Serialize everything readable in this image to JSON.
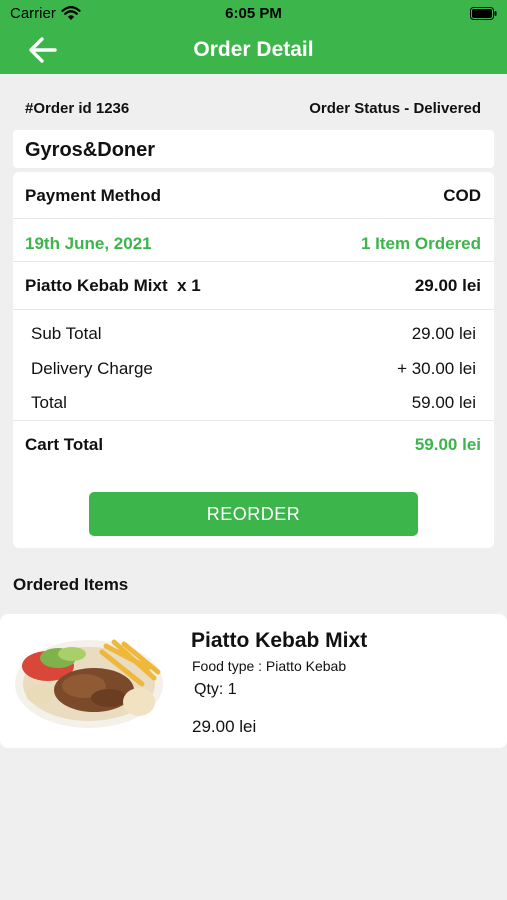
{
  "status_bar": {
    "carrier": "Carrier",
    "time": "6:05 PM"
  },
  "header": {
    "title": "Order Detail",
    "back_icon": "arrow-left-icon"
  },
  "order": {
    "id_label": "#Order id 1236",
    "status_label": "Order Status - Delivered",
    "restaurant": "Gyros&Doner"
  },
  "details": {
    "payment_label": "Payment Method",
    "payment_value": "COD",
    "date": "19th June, 2021",
    "items_ordered": "1 Item Ordered",
    "line_item": "Piatto Kebab Mixt  x 1",
    "line_item_price": "29.00 lei",
    "sub_total_label": "Sub Total",
    "sub_total_value": "29.00 lei",
    "delivery_label": "Delivery Charge",
    "delivery_value": "+ 30.00 lei",
    "total_label": "Total",
    "total_value": "59.00 lei",
    "cart_total_label": "Cart Total",
    "cart_total_value": "59.00 lei",
    "reorder_label": "REORDER"
  },
  "ordered_items": {
    "title": "Ordered Items",
    "items": [
      {
        "name": "Piatto Kebab Mixt",
        "food_type": "Food type : Piatto Kebab",
        "qty": "Qty: 1",
        "price": "29.00 lei"
      }
    ]
  },
  "colors": {
    "accent": "#3cb54b",
    "background": "#efefef"
  }
}
